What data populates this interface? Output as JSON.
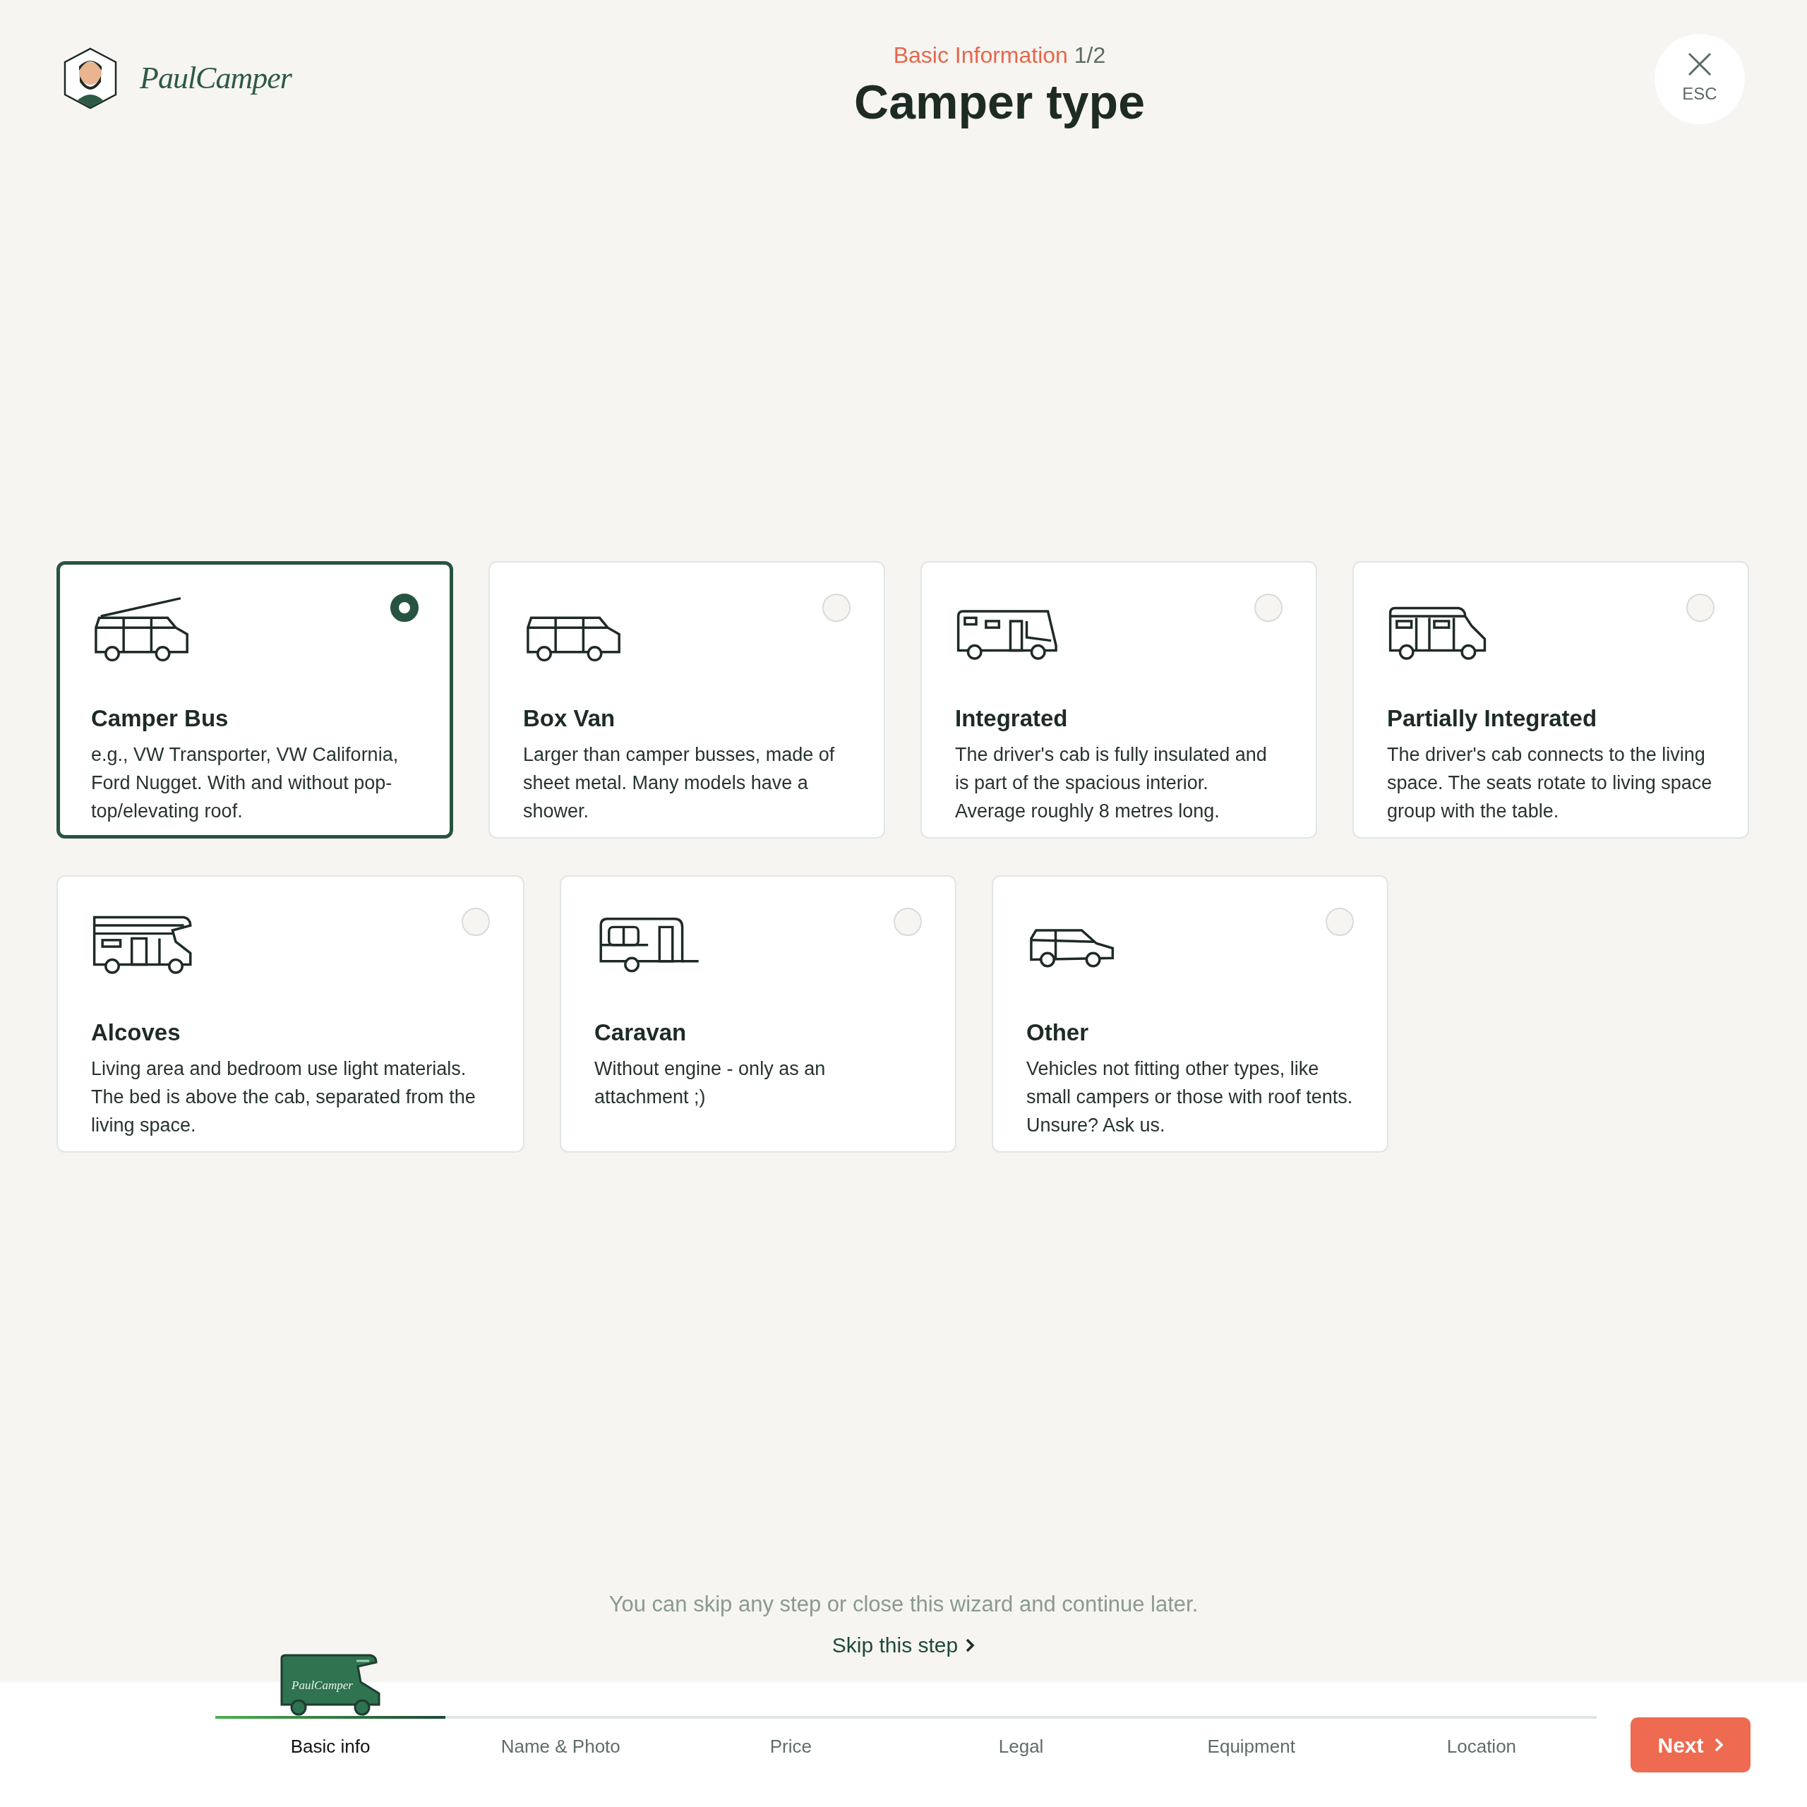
{
  "header": {
    "brand": "PaulCamper",
    "section": "Basic Information",
    "count": "1/2",
    "title": "Camper type",
    "close_label": "ESC"
  },
  "cards": [
    {
      "kind": "bus",
      "title": "Camper Bus",
      "description": "e.g., VW Transporter, VW California, Ford Nugget. With and without pop-top/elevating roof.",
      "selected": true
    },
    {
      "kind": "van",
      "title": "Box Van",
      "description": "Larger than camper busses, made of sheet metal. Many models have a shower.",
      "selected": false
    },
    {
      "kind": "integrated",
      "title": "Integrated",
      "description": "The driver's cab is fully insulated and is part of the spacious interior. Average roughly 8 metres long.",
      "selected": false
    },
    {
      "kind": "partial",
      "title": "Partially Integrated",
      "description": "The driver's cab connects to the living space. The seats rotate to living space group with the table.",
      "selected": false
    },
    {
      "kind": "alcove",
      "title": "Alcoves",
      "description": "Living area and bedroom use light materials. The bed is above the cab, separated from the living space.",
      "selected": false
    },
    {
      "kind": "caravan",
      "title": "Caravan",
      "description": "Without engine - only as an attachment ;)",
      "selected": false
    },
    {
      "kind": "other",
      "title": "Other",
      "description": "Vehicles not fitting other types, like small campers or those with roof tents. Unsure? Ask us.",
      "selected": false
    }
  ],
  "hint": "You can skip any step or close this wizard and continue later.",
  "skip_link": "Skip this step",
  "progress": {
    "van_label": "PaulCamper",
    "steps": [
      {
        "label": "Basic info",
        "selected": true
      },
      {
        "label": "Name & Photo",
        "selected": false
      },
      {
        "label": "Price",
        "selected": false
      },
      {
        "label": "Legal",
        "selected": false
      },
      {
        "label": "Equipment",
        "selected": false
      },
      {
        "label": "Location",
        "selected": false
      }
    ]
  },
  "next_button": "Next"
}
